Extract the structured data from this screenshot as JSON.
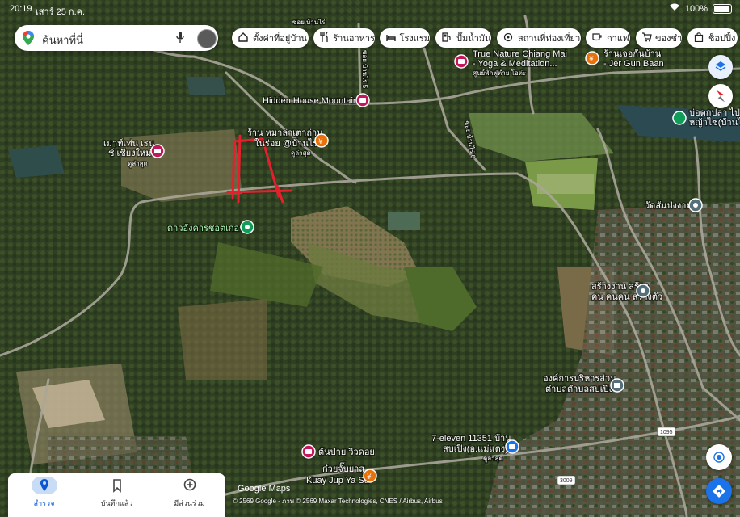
{
  "status": {
    "time": "20:19",
    "date": "เสาร์ 25 ก.ค.",
    "battery": "100%"
  },
  "search": {
    "placeholder": "ค้นหาที่นี่"
  },
  "chips": [
    {
      "label": "ตั้งค่าที่อยู่บ้าน",
      "icon": "home-icon"
    },
    {
      "label": "ร้านอาหาร",
      "icon": "restaurant-icon"
    },
    {
      "label": "โรงแรม",
      "icon": "hotel-icon"
    },
    {
      "label": "ปั๊มน้ำมัน",
      "icon": "gas-icon"
    },
    {
      "label": "สถานที่ท่องเที่ยว",
      "icon": "attraction-icon"
    },
    {
      "label": "กาแฟ",
      "icon": "coffee-icon"
    },
    {
      "label": "ของชำ",
      "icon": "cart-icon"
    },
    {
      "label": "ช็อปปิ้ง",
      "icon": "shopping-icon"
    }
  ],
  "places": {
    "hidden_house": "Hidden House Mountain",
    "true_nature_1": "True Nature Chiang Mai",
    "true_nature_2": "- Yoga & Meditation...",
    "true_nature_sub": "ศูนย์พักฟูต่ำย โอต่ะ",
    "jer_gun_1": "ร้านเจอกันบ้าน",
    "jer_gun_2": "- Jer Gun Baan",
    "fish_pond_1": "บ่อตกปลา ไปง",
    "fish_pond_2": "หญ้าไซ(บ้านไร่)",
    "maw_1": "เมาท์เท่น เรน",
    "maw_2": "ช์ เชียงใหม่",
    "maw_sub": "ดูล่าสุด",
    "restaurant_1": "ร้าน หมาล่าเตาถ่าน",
    "restaurant_2": "ในร่อย @บ้านไร่",
    "restaurant_sub": "ดูล่าสุด",
    "observatory": "ดาวอังคารชอตเกอร์",
    "temple": "วัดสันปงงาม",
    "building_1": "สร้างงาน สร้าง",
    "building_2": "คน คนคน สร้างตัว",
    "org_1": "องค์การบริหารส่วน",
    "org_2": "ตำบลตำบลสบเปิง",
    "seven_1": "7-eleven 11351 บ้าน",
    "seven_2": "สบเปิง(อ.แม่แตง)",
    "seven_sub": "ดูล่าสุด",
    "tonpai": "ต้นปาย วิวดอย",
    "kuay_1": "ก๋วยจั๊บยาสุ",
    "kuay_2": "Kuay Jup Ya Su",
    "road_1": "ซอย บ้านไร่ 6",
    "road_2": "ซอย บ้านไร่",
    "road_3": "ซอย บ้านไร่ 5",
    "shield_1": "1095",
    "shield_2": "3009"
  },
  "branding": {
    "logo": "Google Maps",
    "credit": "© 2569 Google - ภาพ © 2569 Maxar Technologies, CNES / Airbus, Airbus"
  },
  "nav": [
    {
      "label": "สำรวจ",
      "icon": "explore-pin-icon",
      "active": true
    },
    {
      "label": "บันทึกแล้ว",
      "icon": "bookmark-icon",
      "active": false
    },
    {
      "label": "มีส่วนร่วม",
      "icon": "plus-circle-icon",
      "active": false
    }
  ],
  "colors": {
    "restaurant": "#e8710a",
    "attraction": "#c2185b",
    "temple": "#546e7a",
    "parcel": "#e5202d",
    "accent": "#0b57d0"
  }
}
